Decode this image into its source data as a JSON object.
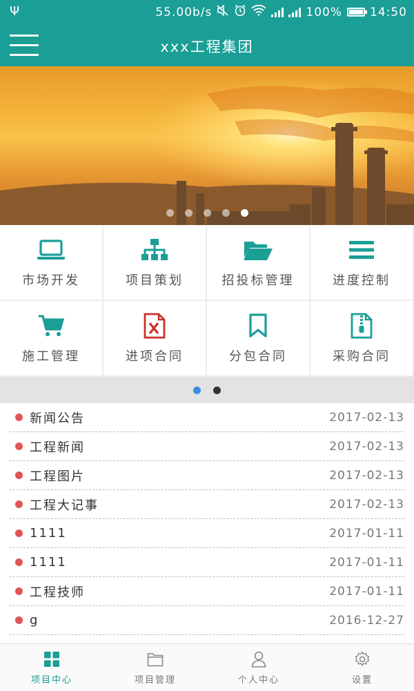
{
  "status_bar": {
    "speed": "55.00b/s",
    "battery": "100%",
    "battery_level": 1.0,
    "time": "14:50"
  },
  "header": {
    "title": "xxx工程集团",
    "menu_icon": "hamburger-icon"
  },
  "banner": {
    "slide_count": 5,
    "active_slide": 5
  },
  "features": {
    "items": [
      {
        "label": "市场开发",
        "icon": "laptop-icon"
      },
      {
        "label": "项目策划",
        "icon": "sitemap-icon"
      },
      {
        "label": "招投标管理",
        "icon": "folder-open-icon"
      },
      {
        "label": "进度控制",
        "icon": "list-icon"
      },
      {
        "label": "施工管理",
        "icon": "cart-icon"
      },
      {
        "label": "进项合同",
        "icon": "excel-file-icon"
      },
      {
        "label": "分包合同",
        "icon": "bookmark-icon"
      },
      {
        "label": "采购合同",
        "icon": "zip-file-icon"
      }
    ],
    "page_count": 2,
    "active_page": 1
  },
  "news": [
    {
      "title": "新闻公告",
      "date": "2017-02-13"
    },
    {
      "title": "工程新闻",
      "date": "2017-02-13"
    },
    {
      "title": "工程图片",
      "date": "2017-02-13"
    },
    {
      "title": "工程大记事",
      "date": "2017-02-13"
    },
    {
      "title": "1111",
      "date": "2017-01-11"
    },
    {
      "title": "1111",
      "date": "2017-01-11"
    },
    {
      "title": "工程技师",
      "date": "2017-01-11"
    },
    {
      "title": "g",
      "date": "2016-12-27"
    }
  ],
  "bottom_nav": {
    "items": [
      {
        "label": "项目中心",
        "icon": "grid-icon",
        "active": true
      },
      {
        "label": "项目管理",
        "icon": "folder-icon",
        "active": false
      },
      {
        "label": "个人中心",
        "icon": "user-icon",
        "active": false
      },
      {
        "label": "设置",
        "icon": "gear-icon",
        "active": false
      }
    ]
  },
  "colors": {
    "primary": "#1a9e96",
    "bullet": "#e05555",
    "page_active": "#3b8ee0"
  }
}
